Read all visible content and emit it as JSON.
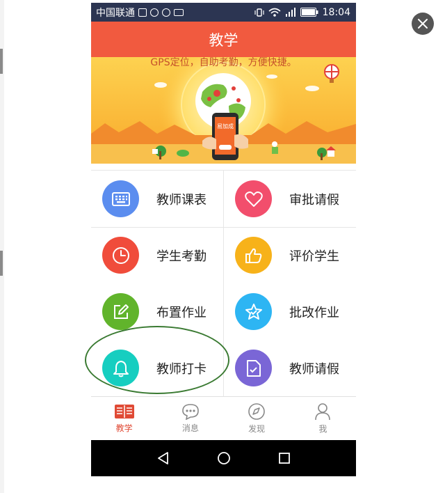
{
  "status_bar": {
    "carrier": "中国联通",
    "time": "18:04"
  },
  "app_bar": {
    "title": "教学"
  },
  "banner": {
    "caption": "GPS定位，自助考勤，方便快捷。",
    "phone_text": "易加成"
  },
  "menu": {
    "items": [
      {
        "label": "教师课表",
        "icon": "keyboard-icon",
        "color": "#5b8def"
      },
      {
        "label": "审批请假",
        "icon": "heart-icon",
        "color": "#f24e6c"
      },
      {
        "label": "学生考勤",
        "icon": "clock-icon",
        "color": "#f04c3b"
      },
      {
        "label": "评价学生",
        "icon": "thumbs-up-icon",
        "color": "#f7b21a"
      },
      {
        "label": "布置作业",
        "icon": "edit-icon",
        "color": "#61b42b"
      },
      {
        "label": "批改作业",
        "icon": "star-check-icon",
        "color": "#2db5f3"
      },
      {
        "label": "教师打卡",
        "icon": "bell-icon",
        "color": "#16cec0"
      },
      {
        "label": "教师请假",
        "icon": "document-check-icon",
        "color": "#7a66d6"
      }
    ]
  },
  "tab_bar": {
    "tabs": [
      {
        "label": "教学",
        "icon": "book-icon",
        "active": true
      },
      {
        "label": "消息",
        "icon": "chat-icon",
        "active": false
      },
      {
        "label": "发现",
        "icon": "compass-icon",
        "active": false
      },
      {
        "label": "我",
        "icon": "person-icon",
        "active": false
      }
    ]
  },
  "colors": {
    "accent": "#f15a3f",
    "status_bar": "#2c3552",
    "highlight": "#3a7a32"
  }
}
